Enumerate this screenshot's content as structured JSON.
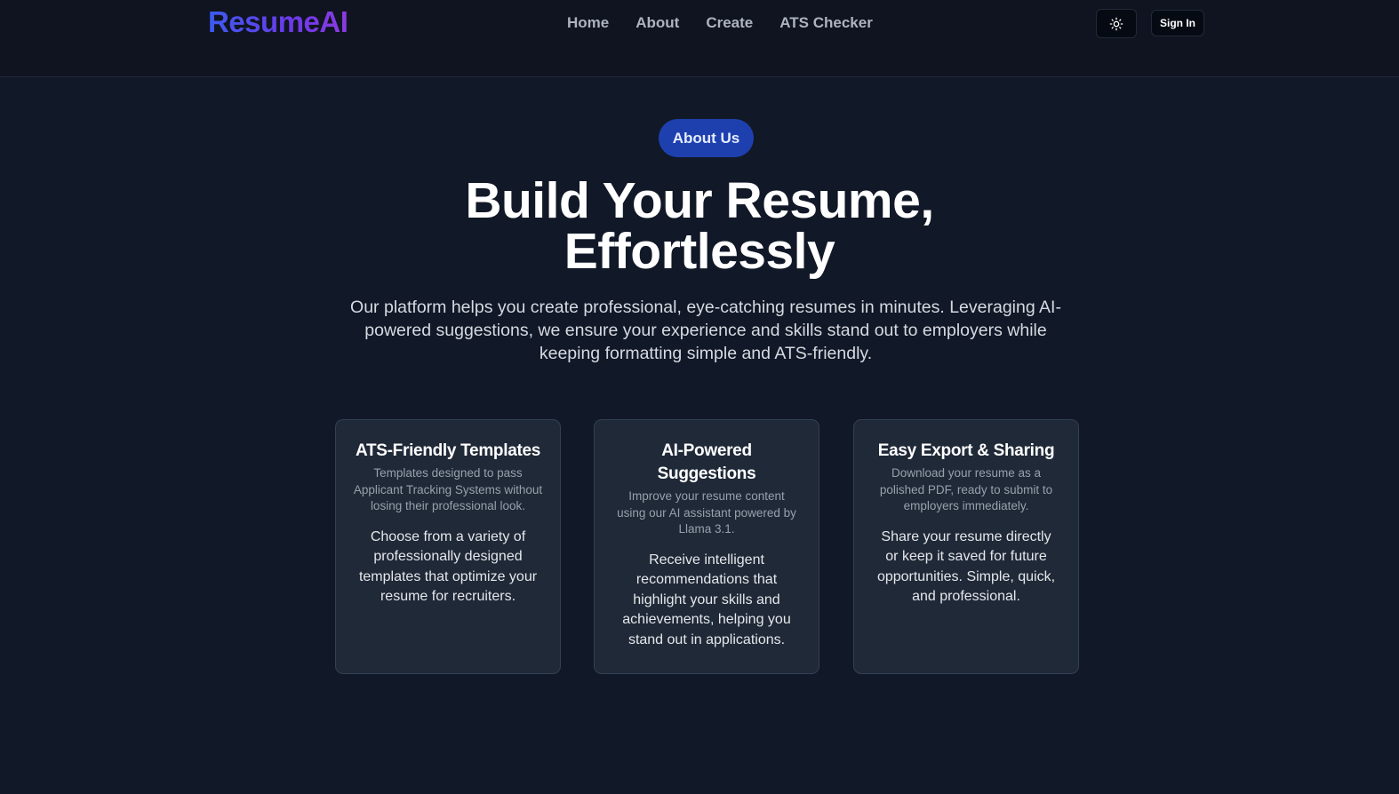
{
  "header": {
    "logo": "ResumeAI",
    "nav": [
      {
        "label": "Home"
      },
      {
        "label": "About"
      },
      {
        "label": "Create"
      },
      {
        "label": "ATS Checker"
      }
    ],
    "theme_toggle_icon": "sun-icon",
    "signin_label": "Sign In"
  },
  "hero": {
    "badge": "About Us",
    "title_line1": "Build Your Resume,",
    "title_line2": "Effortlessly",
    "description": "Our platform helps you create professional, eye-catching resumes in minutes. Leveraging AI-powered suggestions, we ensure your experience and skills stand out to employers while keeping formatting simple and ATS-friendly."
  },
  "features": [
    {
      "title": "ATS-Friendly Templates",
      "subtitle": "Templates designed to pass Applicant Tracking Systems without losing their professional look.",
      "body": "Choose from a variety of professionally designed templates that optimize your resume for recruiters."
    },
    {
      "title": "AI-Powered Suggestions",
      "subtitle": "Improve your resume content using our AI assistant powered by Llama 3.1.",
      "body": "Receive intelligent recommendations that highlight your skills and achievements, helping you stand out in applications."
    },
    {
      "title": "Easy Export & Sharing",
      "subtitle": "Download your resume as a polished PDF, ready to submit to employers immediately.",
      "body": "Share your resume directly or keep it saved for future opportunities. Simple, quick, and professional."
    }
  ],
  "colors": {
    "background": "#111827",
    "header_bg": "#0f1420",
    "card_bg": "#1f2937",
    "badge_bg": "#1e40af",
    "logo_gradient_start": "#3b5bf0",
    "logo_gradient_end": "#8b3be0"
  }
}
